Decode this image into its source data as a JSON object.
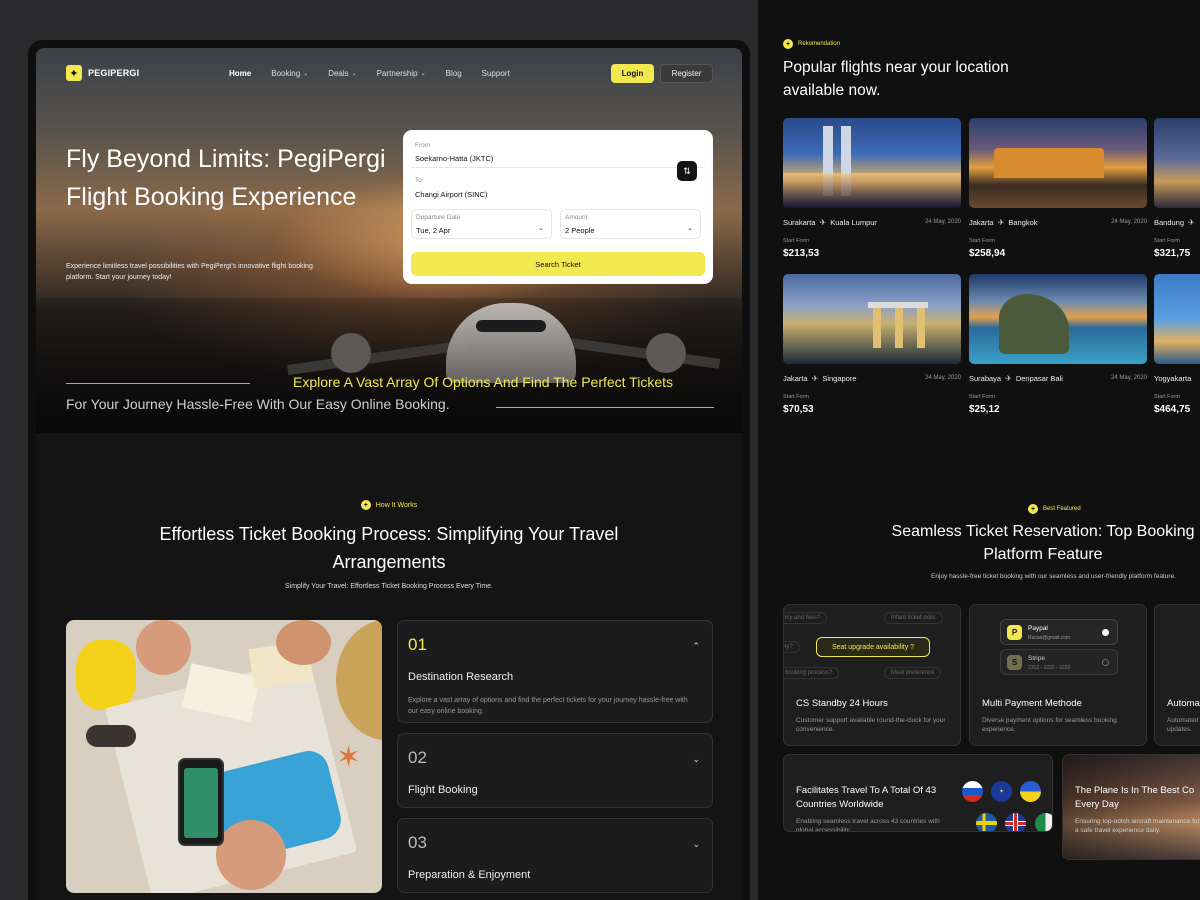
{
  "nav": {
    "logo": "PEGIPERGI",
    "items": [
      {
        "label": "Home",
        "active": true,
        "dropdown": false
      },
      {
        "label": "Booking",
        "active": false,
        "dropdown": true
      },
      {
        "label": "Deals",
        "active": false,
        "dropdown": true
      },
      {
        "label": "Partnership",
        "active": false,
        "dropdown": true
      },
      {
        "label": "Blog",
        "active": false,
        "dropdown": false
      },
      {
        "label": "Support",
        "active": false,
        "dropdown": false
      }
    ],
    "login": "Login",
    "register": "Register"
  },
  "hero": {
    "title": "Fly Beyond Limits: PegiPergi Flight Booking Experience",
    "subtitle": "Experience limitless travel possibilities with PegiPergi's innovative flight booking platform. Start your journey today!",
    "tagline_1": "Explore A Vast Array Of Options And Find The Perfect Tickets",
    "tagline_2": "For Your Journey Hassle-Free With Our Easy Online Booking."
  },
  "search": {
    "from_label": "From",
    "from_value": "Soekarno-Hatta (JKTC)",
    "to_label": "To",
    "to_value": "Changi Airport (SINC)",
    "date_label": "Departure Date",
    "date_value": "Tue, 2 Apr",
    "amount_label": "Amount",
    "amount_value": "2 People",
    "button": "Search Ticket"
  },
  "how": {
    "badge": "How It Works",
    "title": "Effortless Ticket Booking Process: Simplifying Your Travel Arrangements",
    "subtitle": "Simplify Your Travel: Effortless Ticket Booking Process Every Time.",
    "steps": [
      {
        "num": "01",
        "title": "Destination Research",
        "desc": "Explore a vast array of options and find the perfect tickets for your journey hassle-free with our easy online booking.",
        "open": true
      },
      {
        "num": "02",
        "title": "Flight Booking",
        "desc": "",
        "open": false
      },
      {
        "num": "03",
        "title": "Preparation & Enjoyment",
        "desc": "",
        "open": false
      }
    ]
  },
  "recommend": {
    "badge": "Rekomendation",
    "title": "Popular flights near your location available now.",
    "start_label": "Start Form",
    "cards": [
      {
        "from": "Surakarta",
        "to": "Kuala Lumpur",
        "date": "24 May, 2020",
        "price": "$213,53",
        "scene": "city-night"
      },
      {
        "from": "Jakarta",
        "to": "Bangkok",
        "date": "24 May, 2020",
        "price": "$258,94",
        "scene": "temple-sunset"
      },
      {
        "from": "Bandung",
        "to": "",
        "date": "",
        "price": "$321,75",
        "scene": "palace-dusk"
      },
      {
        "from": "Jakarta",
        "to": "Singapore",
        "date": "24 May, 2020",
        "price": "$70,53",
        "scene": "marina-bay"
      },
      {
        "from": "Surabaya",
        "to": "Denpasar Bali",
        "date": "24 May, 2020",
        "price": "$25,12",
        "scene": "cliff-coast"
      },
      {
        "from": "Yogyakarta",
        "to": "",
        "date": "",
        "price": "$464,75",
        "scene": "blue-sea"
      }
    ]
  },
  "featured": {
    "badge": "Best Featured",
    "title_1": "Seamless Ticket Reservation: Top Booking",
    "title_2": "Platform Feature",
    "subtitle": "Enjoy hassle-free ticket booking with our seamless and user-friendly platform feature.",
    "cs": {
      "chips": [
        "ncy and fees?",
        "Infant ticket polic",
        "ny?",
        "booking process?",
        "Meal preference"
      ],
      "seat_pill": "Seat upgrade availability ?",
      "title": "CS Standby 24 Hours",
      "desc": "Customer support available round-the-clock for your convenience."
    },
    "payment": {
      "methods": [
        {
          "name": "Paypal",
          "detail": "Rucas@gmail.com",
          "icon": "P",
          "selected": true
        },
        {
          "name": "Stripe",
          "detail": "2312 - 3232 - 3232",
          "icon": "S",
          "selected": false
        }
      ],
      "title": "Multi Payment Methode",
      "desc": "Diverse payment options for seamless booking experience."
    },
    "auto": {
      "title": "Automa",
      "desc_1": "Automated",
      "desc_2": "updates."
    },
    "countries": {
      "title": "Facilitates Travel To A Total Of 43 Countries Worldwide",
      "desc": "Enabling seamless travel across 43 countries with global accessibility.",
      "flags": [
        "russia-flag",
        "eu-flag",
        "ukraine-flag",
        "sweden-flag",
        "uk-flag",
        "ireland-flag"
      ]
    },
    "plane": {
      "title": "The Plane Is In The Best Co",
      "title_2": "Every Day",
      "desc": "Ensuring top-notch aircraft maintenance for a safe travel experience daily."
    }
  },
  "colors": {
    "accent": "#f2e84f",
    "bg": "#141414",
    "panel": "#101010"
  }
}
